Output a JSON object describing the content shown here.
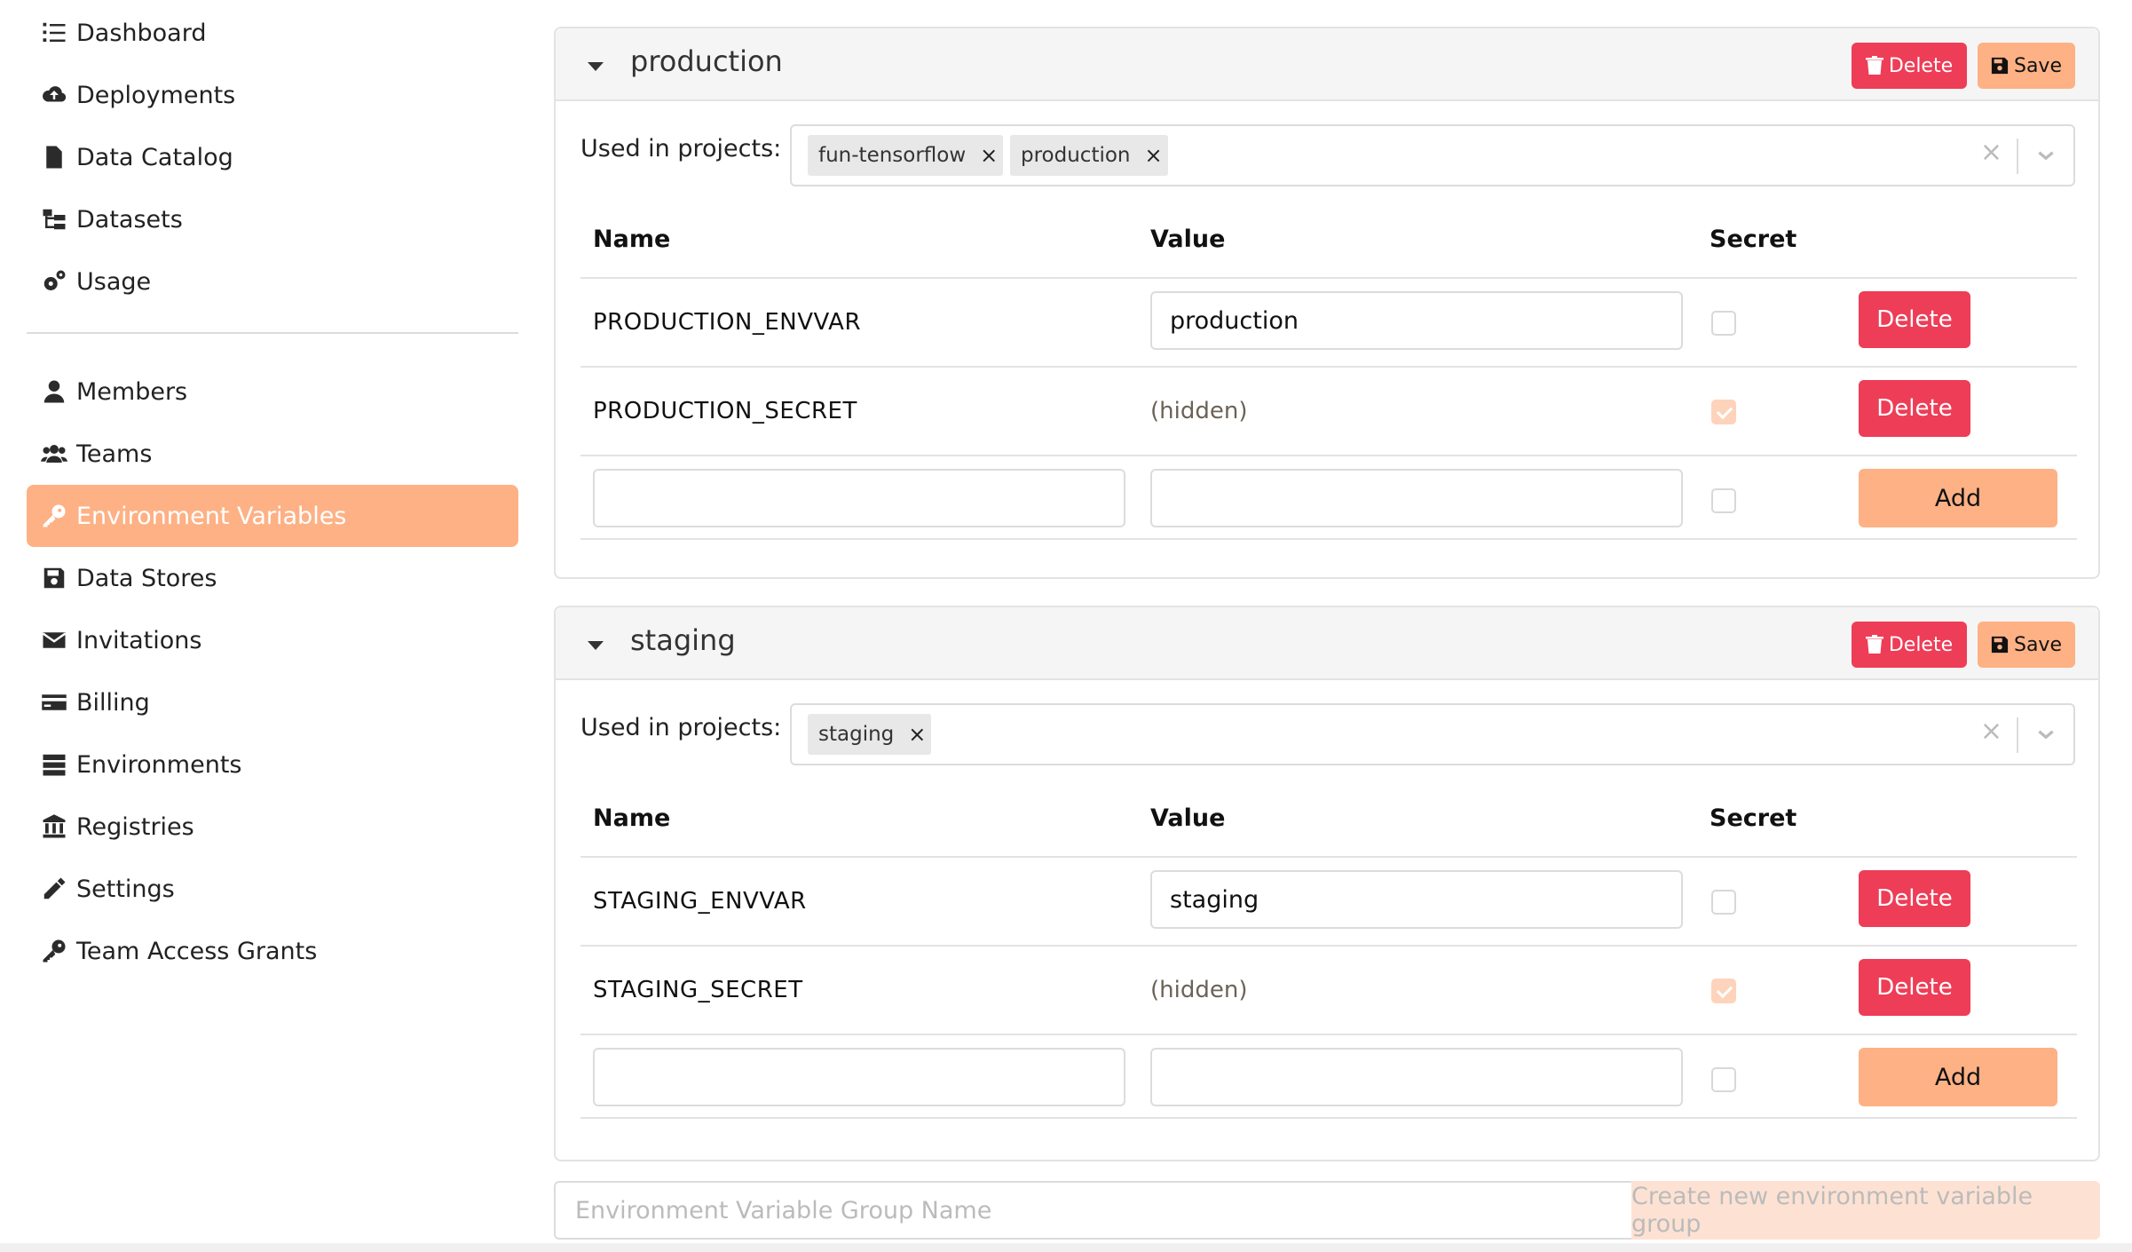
{
  "sidebar": {
    "items": [
      {
        "label": "Dashboard",
        "icon": "list-icon"
      },
      {
        "label": "Deployments",
        "icon": "cloud-upload-icon"
      },
      {
        "label": "Data Catalog",
        "icon": "file-icon"
      },
      {
        "label": "Datasets",
        "icon": "folder-tree-icon"
      },
      {
        "label": "Usage",
        "icon": "cogs-icon"
      },
      {
        "label": "Members",
        "icon": "user-icon"
      },
      {
        "label": "Teams",
        "icon": "users-icon"
      },
      {
        "label": "Environment Variables",
        "icon": "key-icon",
        "active": true
      },
      {
        "label": "Data Stores",
        "icon": "save-icon"
      },
      {
        "label": "Invitations",
        "icon": "envelope-icon"
      },
      {
        "label": "Billing",
        "icon": "credit-card-icon"
      },
      {
        "label": "Environments",
        "icon": "server-icon"
      },
      {
        "label": "Registries",
        "icon": "landmark-icon"
      },
      {
        "label": "Settings",
        "icon": "pencil-icon"
      },
      {
        "label": "Team Access Grants",
        "icon": "key-icon"
      }
    ]
  },
  "groups": [
    {
      "name": "production",
      "delete_label": "Delete",
      "save_label": "Save",
      "projects_label": "Used in projects:",
      "projects": [
        "fun-tensorflow",
        "production"
      ],
      "columns": {
        "name": "Name",
        "value": "Value",
        "secret": "Secret"
      },
      "rows": [
        {
          "name": "PRODUCTION_ENVVAR",
          "value": "production",
          "secret": false,
          "action": "Delete"
        },
        {
          "name": "PRODUCTION_SECRET",
          "value": "(hidden)",
          "secret": true,
          "action": "Delete"
        }
      ],
      "add_label": "Add"
    },
    {
      "name": "staging",
      "delete_label": "Delete",
      "save_label": "Save",
      "projects_label": "Used in projects:",
      "projects": [
        "staging"
      ],
      "columns": {
        "name": "Name",
        "value": "Value",
        "secret": "Secret"
      },
      "rows": [
        {
          "name": "STAGING_ENVVAR",
          "value": "staging",
          "secret": false,
          "action": "Delete"
        },
        {
          "name": "STAGING_SECRET",
          "value": "(hidden)",
          "secret": true,
          "action": "Delete"
        }
      ],
      "add_label": "Add"
    }
  ],
  "new_group": {
    "placeholder": "Environment Variable Group Name",
    "button_label": "Create new environment variable group"
  },
  "colors": {
    "accent": "#fdb185",
    "danger": "#ee3d57",
    "secret_checked": "#fdd3bb"
  }
}
